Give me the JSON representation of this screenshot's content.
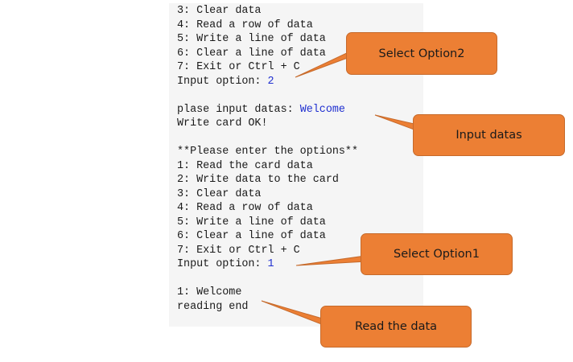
{
  "console": {
    "lines": [
      {
        "text": "3: Clear data"
      },
      {
        "text": "4: Read a row of data"
      },
      {
        "text": "5: Write a line of data"
      },
      {
        "text": "6: Clear a line of data"
      },
      {
        "text": "7: Exit or Ctrl + C"
      },
      {
        "text": "Input option: ",
        "input": "2"
      },
      {
        "text": ""
      },
      {
        "text": "plase input datas: ",
        "input": "Welcome"
      },
      {
        "text": "Write card OK!"
      },
      {
        "text": ""
      },
      {
        "text": "**Please enter the options**"
      },
      {
        "text": "1: Read the card data"
      },
      {
        "text": "2: Write data to the card"
      },
      {
        "text": "3: Clear data"
      },
      {
        "text": "4: Read a row of data"
      },
      {
        "text": "5: Write a line of data"
      },
      {
        "text": "6: Clear a line of data"
      },
      {
        "text": "7: Exit or Ctrl + C"
      },
      {
        "text": "Input option: ",
        "input": "1"
      },
      {
        "text": ""
      },
      {
        "text": "1: Welcome"
      },
      {
        "text": "reading end"
      }
    ]
  },
  "callouts": {
    "select_option2": "Select Option2",
    "input_datas": "Input datas",
    "select_option1": "Select Option1",
    "read_the_data": "Read the data"
  },
  "colors": {
    "callout_fill": "#ec7f34",
    "input_text": "#1f2fd0",
    "console_background": "#f5f5f5"
  }
}
